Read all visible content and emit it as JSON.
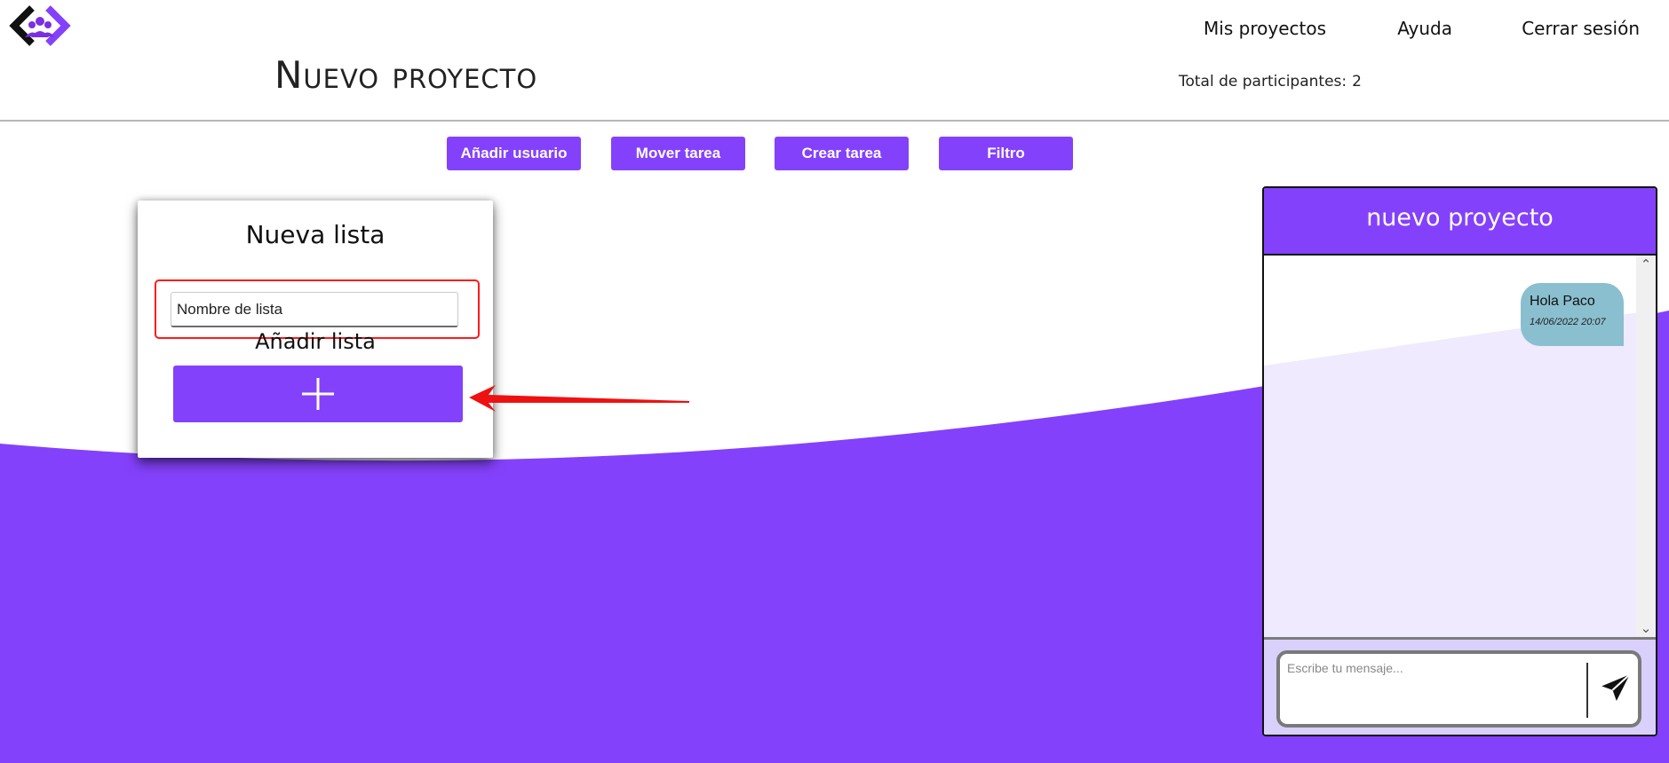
{
  "nav": {
    "my_projects": "Mis proyectos",
    "help": "Ayuda",
    "logout": "Cerrar sesión"
  },
  "page": {
    "title": "Nuevo proyecto",
    "participants_label": "Total de participantes:",
    "participants_count": "2"
  },
  "toolbar": {
    "add_user": "Añadir usuario",
    "move_task": "Mover tarea",
    "create_task": "Crear tarea",
    "filter": "Filtro"
  },
  "new_list": {
    "title": "Nueva lista",
    "input_placeholder": "Nombre de lista",
    "input_value": "",
    "add_label": "Añadir lista",
    "add_icon": "plus-icon"
  },
  "chat": {
    "header": "nuevo proyecto",
    "messages": [
      {
        "text": "Hola Paco",
        "time": "14/06/2022 20:07"
      }
    ],
    "input_placeholder": "Escribe tu mensaje...",
    "send_icon": "send-icon"
  },
  "colors": {
    "accent": "#8441fb",
    "wave_light": "#efeafd",
    "bubble": "#8abfcf",
    "annotation": "#ff1a1a"
  }
}
